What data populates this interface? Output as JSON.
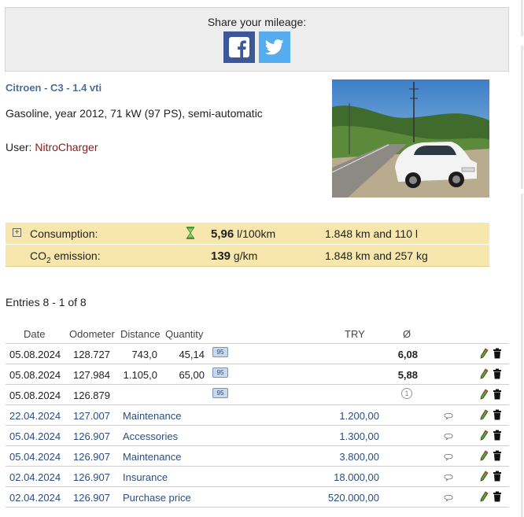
{
  "share": {
    "title": "Share your mileage:"
  },
  "vehicle": {
    "title": "Citroen - C3 - 1.4 vti",
    "specs": "Gasoline, year 2012, 71 kW (97 PS), semi-automatic",
    "user_label": "User: ",
    "user_name": "NitroCharger"
  },
  "stats": {
    "consumption": {
      "label": "Consumption:",
      "value": "5,96",
      "unit": " l/100km",
      "basis": "1.848 km and 110 l"
    },
    "emission": {
      "label_main": "CO",
      "label_sub": "2",
      "label_tail": " emission:",
      "value": "139",
      "unit": " g/km",
      "basis": "1.848 km and 257 kg"
    }
  },
  "entries_count": "Entries 8 - 1 of 8",
  "table": {
    "headers": {
      "date": "Date",
      "odometer": "Odometer",
      "distance": "Distance",
      "quantity": "Quantity",
      "currency": "TRY",
      "avg": "Ø"
    },
    "rows": [
      {
        "date": "05.08.2024",
        "odometer": "128.727",
        "distance": "743,0",
        "quantity": "45,14",
        "fuel": "95",
        "amount": "",
        "avg": "6,08"
      },
      {
        "date": "05.08.2024",
        "odometer": "127.984",
        "distance": "1.105,0",
        "quantity": "65,00",
        "fuel": "95",
        "amount": "",
        "avg": "5,88"
      },
      {
        "date": "05.08.2024",
        "odometer": "126.879",
        "distance": "",
        "quantity": "",
        "fuel": "95",
        "amount": "",
        "avg": "",
        "marker": "1"
      },
      {
        "date": "22.04.2024",
        "odometer": "127.007",
        "type": "Maintenance",
        "amount": "1.200,00"
      },
      {
        "date": "05.04.2024",
        "odometer": "126.907",
        "type": "Accessories",
        "amount": "1.300,00"
      },
      {
        "date": "05.04.2024",
        "odometer": "126.907",
        "type": "Maintenance",
        "amount": "3.800,00"
      },
      {
        "date": "02.04.2024",
        "odometer": "126.907",
        "type": "Insurance",
        "amount": "18.000,00"
      },
      {
        "date": "02.04.2024",
        "odometer": "126.907",
        "type": "Purchase price",
        "amount": "520.000,00"
      }
    ]
  },
  "colors": {
    "accent": "#4a6e9e",
    "username": "#8b1a1a",
    "stats_bg": "#f7e7ad",
    "facebook": "#3b5998",
    "twitter": "#55acee"
  },
  "icons": [
    "facebook-icon",
    "twitter-icon",
    "hourglass-icon",
    "comment-icon",
    "pencil-icon",
    "trash-icon"
  ]
}
